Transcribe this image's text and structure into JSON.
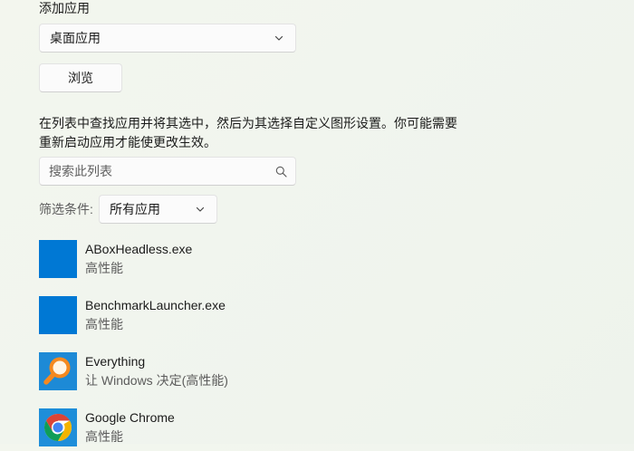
{
  "section": {
    "add_app_label": "添加应用"
  },
  "app_type_dropdown": {
    "selected": "桌面应用"
  },
  "browse_button": {
    "label": "浏览"
  },
  "description": "在列表中查找应用并将其选中，然后为其选择自定义图形设置。你可能需要重新启动应用才能使更改生效。",
  "search": {
    "placeholder": "搜索此列表",
    "icon": "search-icon"
  },
  "filter": {
    "label": "筛选条件:",
    "selected": "所有应用"
  },
  "apps": [
    {
      "name": "ABoxHeadless.exe",
      "preference": "高性能",
      "icon": "blue-app-tile-icon"
    },
    {
      "name": "BenchmarkLauncher.exe",
      "preference": "高性能",
      "icon": "blue-app-tile-icon"
    },
    {
      "name": "Everything",
      "preference": "让 Windows 决定(高性能)",
      "icon": "magnifier-app-icon"
    },
    {
      "name": "Google Chrome",
      "preference": "高性能",
      "icon": "chrome-icon"
    }
  ],
  "colors": {
    "accent_tile": "#0078d4",
    "everything_tile": "#1d8ad6",
    "everything_lens": "#f5891f"
  }
}
